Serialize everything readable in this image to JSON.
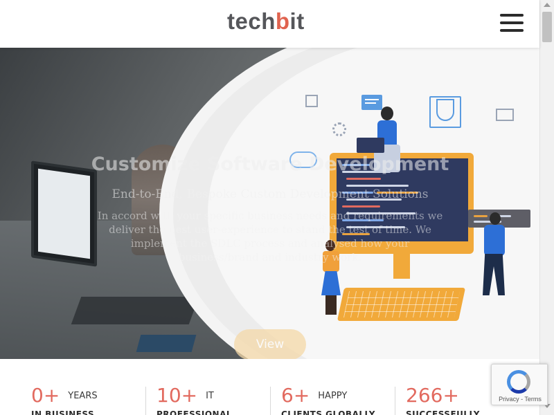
{
  "header": {
    "logo_part1": "tech",
    "logo_accent": "b",
    "logo_part2": "it"
  },
  "hero": {
    "title": "Customize Software Development",
    "subtitle": "End-to-End, Bespoke Custom Development Solutions",
    "description": "In accord with your specific business needs and requirements we deliver the best user-experience to stand the test of time. We implement the SDLC process and analysed how your business/brand and industry work.",
    "button_label": "View",
    "slide_count": 6,
    "active_slide": 1
  },
  "stats": [
    {
      "number": "0+",
      "unit": "YEARS",
      "sub": "IN BUSINESS"
    },
    {
      "number": "10+",
      "unit": "IT",
      "sub": "PROFESSIONAL"
    },
    {
      "number": "6+",
      "unit": "HAPPY",
      "sub": "CLIENTS GLOBALLY"
    },
    {
      "number": "266+",
      "unit": "",
      "sub": "SUCCESSFULLY"
    }
  ],
  "recaptcha": {
    "text": "Privacy - Terms"
  },
  "colors": {
    "accent": "#e26a5f",
    "logo_gray": "#55565a",
    "illustration_orange": "#f1a93a",
    "illustration_blue": "#2d6fd6"
  },
  "icons": {
    "menu": "hamburger-menu-icon",
    "recaptcha": "recaptcha-logo-icon"
  }
}
